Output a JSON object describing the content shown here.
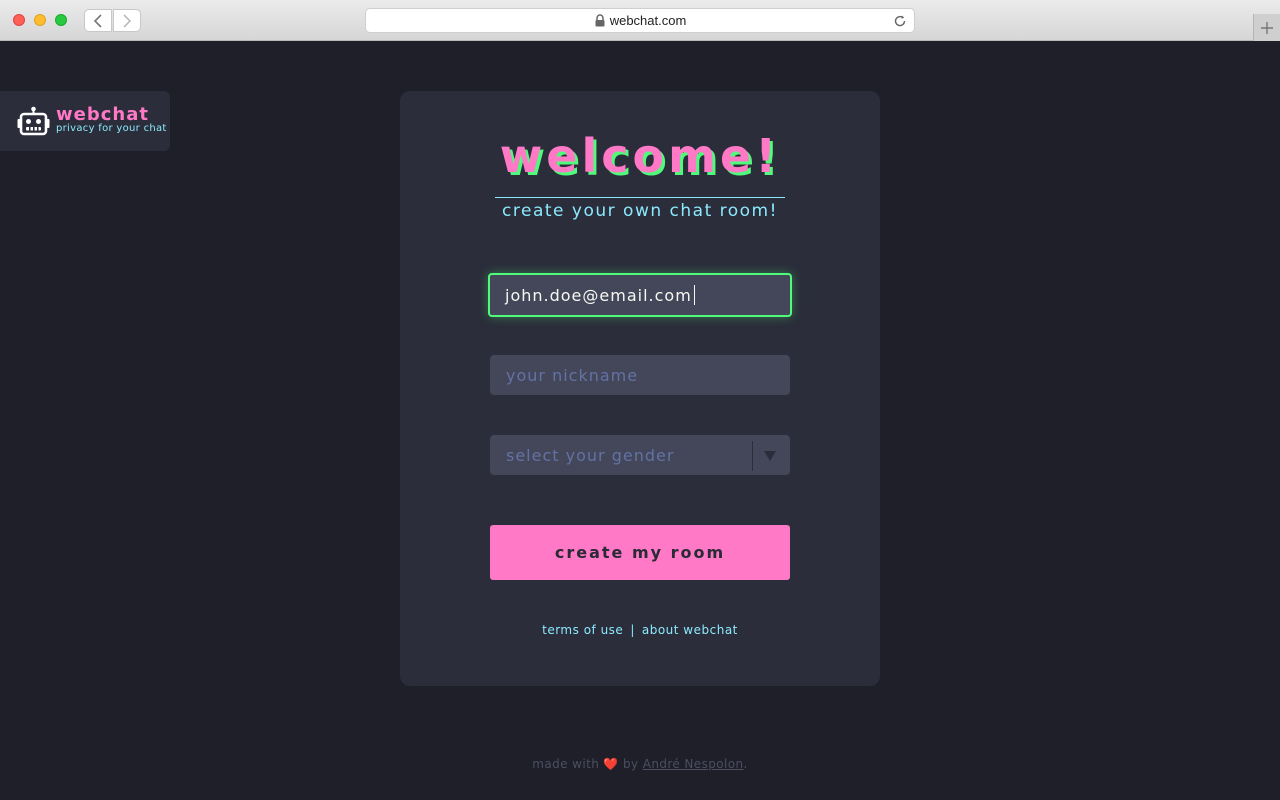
{
  "browser": {
    "url": "webchat.com"
  },
  "logo": {
    "name": "webchat",
    "tagline": "privacy for your chat"
  },
  "form": {
    "title": "welcome!",
    "subtitle": "create your own chat room!",
    "email_value": "john.doe@email.com",
    "nickname_placeholder": "your nickname",
    "gender_placeholder": "select your gender",
    "submit_label": "create my room"
  },
  "links": {
    "terms": "terms of use",
    "separator": "|",
    "about": "about webchat"
  },
  "footer": {
    "prefix": "made with",
    "heart": "❤️",
    "by": "by",
    "author": "André Nespolon",
    "suffix": "."
  },
  "colors": {
    "background": "#1f1f29",
    "card": "#2b2d3a",
    "pink": "#ff79c6",
    "green": "#50fa7b",
    "cyan": "#8be9fd",
    "input": "#44475a",
    "placeholder": "#6272a4"
  },
  "icons": {
    "logo": "robot-icon",
    "select": "chevron-down-icon",
    "secure": "lock-icon",
    "reload": "reload-icon"
  }
}
